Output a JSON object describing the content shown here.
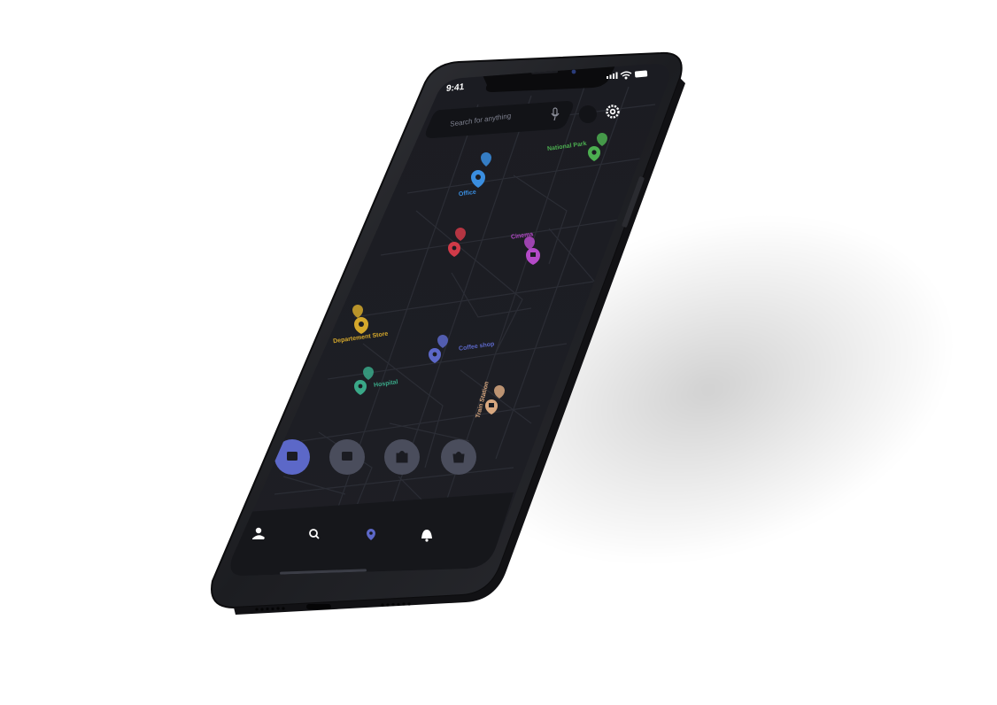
{
  "status_bar": {
    "time": "9:41"
  },
  "search": {
    "placeholder": "Search for anything"
  },
  "places": [
    {
      "label": "Office",
      "color": "#3a8ee0"
    },
    {
      "label": "National Park",
      "color": "#4caf50"
    },
    {
      "label": "Cinema",
      "color": "#b44ac8"
    },
    {
      "label": "Departement Store",
      "color": "#d4a82c"
    },
    {
      "label": "Coffee shop",
      "color": "#5c68c8"
    },
    {
      "label": "Hospital",
      "color": "#3aa888"
    },
    {
      "label": "Train Station",
      "color": "#d8a880"
    },
    {
      "label": "",
      "color": "#d03a48"
    }
  ],
  "colors": {
    "map_bg": "#1c1d22",
    "map_road": "#2a2c33",
    "tab_bar": "#16171b",
    "accent": "#5c68c8",
    "chip_inactive": "#4a4d5c"
  },
  "icons": {
    "settings": "gear-icon",
    "mic": "mic-icon",
    "profile": "profile-icon",
    "search": "search-icon",
    "location": "location-pin-icon",
    "notifications": "bell-icon"
  }
}
